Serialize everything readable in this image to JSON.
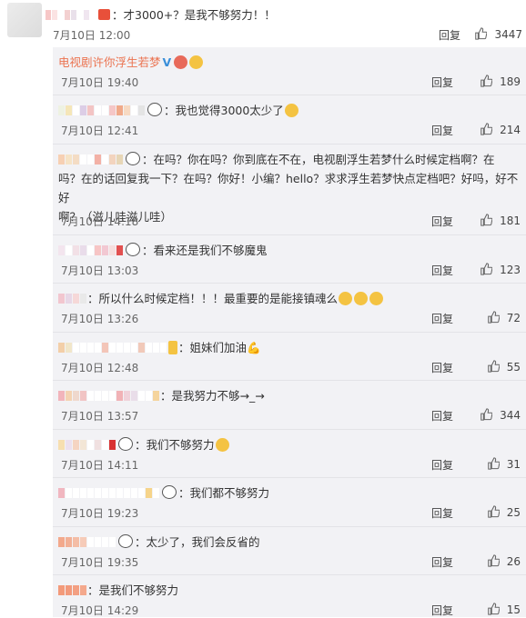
{
  "post": {
    "text": "：才3000+？是我不够努力！！",
    "time": "7月10日 12:00",
    "reply_label": "回复",
    "likes": "3447"
  },
  "replies": [
    {
      "user": "电视剧许你浮生若梦",
      "text": "",
      "time": "7月10日 19:40",
      "reply_label": "回复",
      "likes": "189"
    },
    {
      "user": "",
      "text": "：我也觉得3000太少了",
      "time": "7月10日 12:41",
      "reply_label": "回复",
      "likes": "214"
    },
    {
      "user": "",
      "text_line1": "：在吗？你在吗？你到底在不在，电视剧浮生若梦什么时候定档啊？在",
      "text_line2": "吗？在的话回复我一下？在吗？你好！小编？hello？求求浮生若梦快点定档吧？好吗，好不好",
      "text_line3": "啊？（滋儿哇滋儿哇）",
      "time": "7月10日 14:18",
      "reply_label": "回复",
      "likes": "181"
    },
    {
      "user": "",
      "text": "：看来还是我们不够魔鬼",
      "time": "7月10日 13:03",
      "reply_label": "回复",
      "likes": "123"
    },
    {
      "user": "",
      "text": "：所以什么时候定档！！！最重要的是能接镇魂么",
      "time": "7月10日 13:26",
      "reply_label": "回复",
      "likes": "72"
    },
    {
      "user": "",
      "text": "：姐妹们加油",
      "time": "7月10日 12:48",
      "reply_label": "回复",
      "likes": "55"
    },
    {
      "user": "",
      "text": "：是我努力不够→_→",
      "time": "7月10日 13:57",
      "reply_label": "回复",
      "likes": "344"
    },
    {
      "user": "",
      "text": "：我们不够努力",
      "time": "7月10日 14:11",
      "reply_label": "回复",
      "likes": "31"
    },
    {
      "user": "",
      "text": "：我们都不够努力",
      "time": "7月10日 19:23",
      "reply_label": "回复",
      "likes": "25"
    },
    {
      "user": "",
      "text": "：太少了，我们会反省的",
      "time": "7月10日 19:35",
      "reply_label": "回复",
      "likes": "26"
    },
    {
      "user": "",
      "text": "：是我们不够努力",
      "time": "7月10日 14:29",
      "reply_label": "回复",
      "likes": "15"
    }
  ],
  "colors": {
    "accent": "#eb7350",
    "reply_bg": "#f2f2f5",
    "vbadge": "#3a8fd9"
  }
}
